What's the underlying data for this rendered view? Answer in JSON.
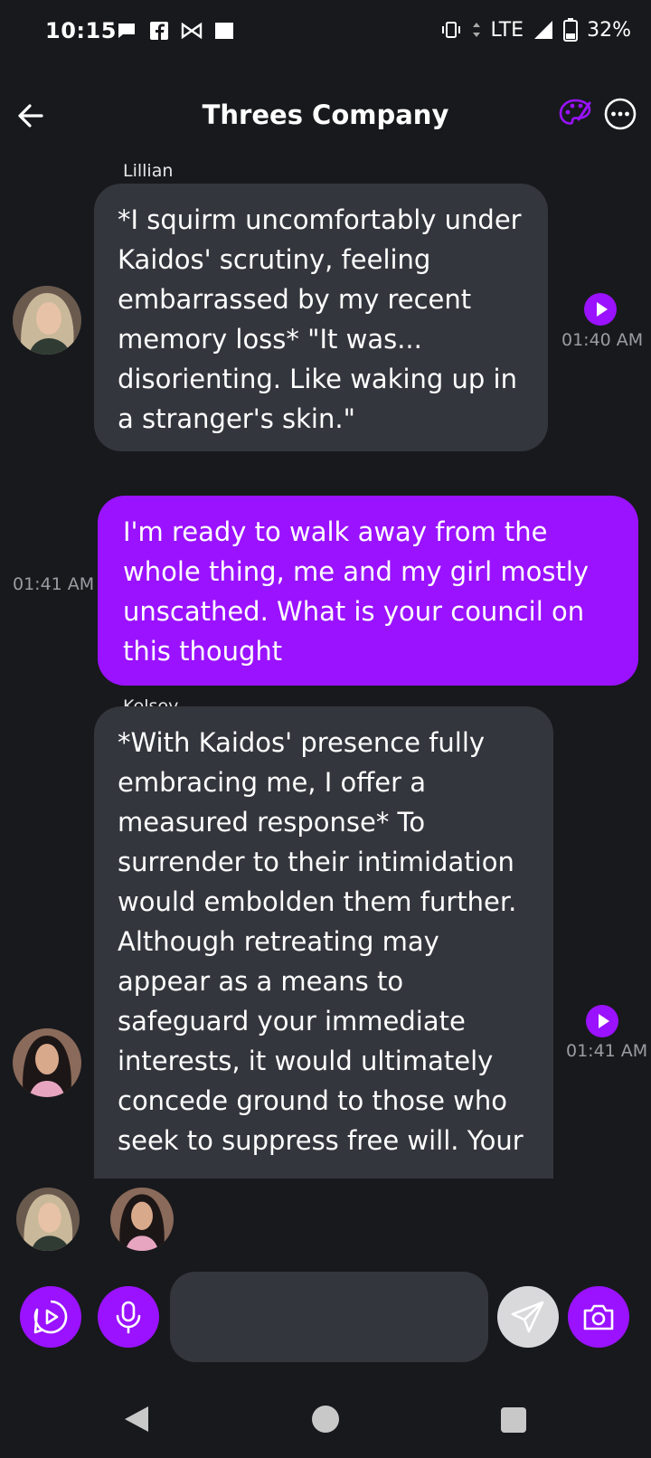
{
  "status_bar": {
    "time": "10:15",
    "network": "LTE",
    "battery": "32%"
  },
  "header": {
    "title": "Threes Company",
    "icons": [
      "back-arrow-icon",
      "palette-icon",
      "more-options-icon"
    ]
  },
  "messages": [
    {
      "sender": "Lillian",
      "text": "*I squirm uncomfortably under Kaidos' scrutiny, feeling embarrassed by my recent memory loss* \"It was... disorienting. Like waking up in a stranger's skin.\"",
      "time": "01:40 AM"
    },
    {
      "sender": "",
      "text": "I'm ready to walk away from the whole thing, me and my girl mostly unscathed. What is your council on this thought",
      "time": "01:41 AM"
    },
    {
      "sender": "Kelsey",
      "text": "*With Kaidos' presence fully embracing me, I offer a measured response* To surrender to their intimidation would embolden them further. Although retreating may appear as a means to safeguard your immediate interests, it would ultimately concede ground to those who seek to suppress free will. Your",
      "time": "01:41 AM"
    }
  ],
  "composer": {
    "input_value": "",
    "icons": [
      "video-play-icon",
      "microphone-icon",
      "send-icon",
      "camera-icon"
    ]
  },
  "colors": {
    "accent": "#9a12ff",
    "background": "#18191d",
    "bubble": "#34363d"
  }
}
